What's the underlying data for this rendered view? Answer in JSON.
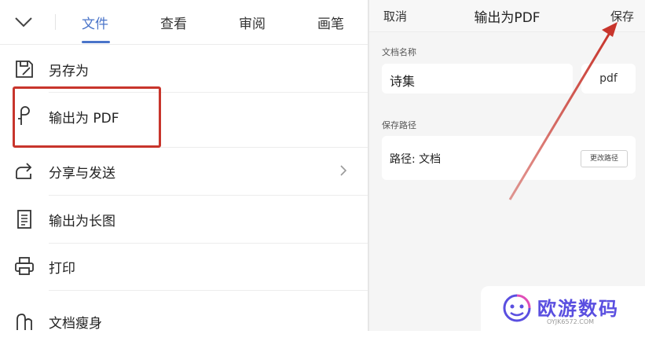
{
  "menu_toolbar": {
    "tabs": [
      {
        "label": "文件"
      },
      {
        "label": "查看"
      },
      {
        "label": "审阅"
      },
      {
        "label": "画笔"
      }
    ]
  },
  "file_menu": {
    "items": [
      {
        "label": "另存为",
        "icon": "save-as-icon"
      },
      {
        "label": "输出为 PDF",
        "icon": "pdf-icon"
      },
      {
        "label": "分享与发送",
        "icon": "share-icon"
      },
      {
        "label": "输出为长图",
        "icon": "long-image-icon"
      },
      {
        "label": "打印",
        "icon": "printer-icon"
      },
      {
        "label": "文档瘦身",
        "icon": "slim-document-icon"
      }
    ]
  },
  "export_dialog": {
    "cancel_label": "取消",
    "title": "输出为PDF",
    "save_label": "保存",
    "doc_name_label": "文档名称",
    "doc_name_value": "诗集",
    "extension": "pdf",
    "save_path_label": "保存路径",
    "path_text": "路径: 文档",
    "change_path_label": "更改路径"
  },
  "watermark": {
    "text": "欧游数码",
    "sub": "OYJK6572.COM"
  },
  "colors": {
    "accent": "#4a74c9",
    "highlight_red": "#c8352c",
    "watermark_purple": "#5a4fe0"
  }
}
